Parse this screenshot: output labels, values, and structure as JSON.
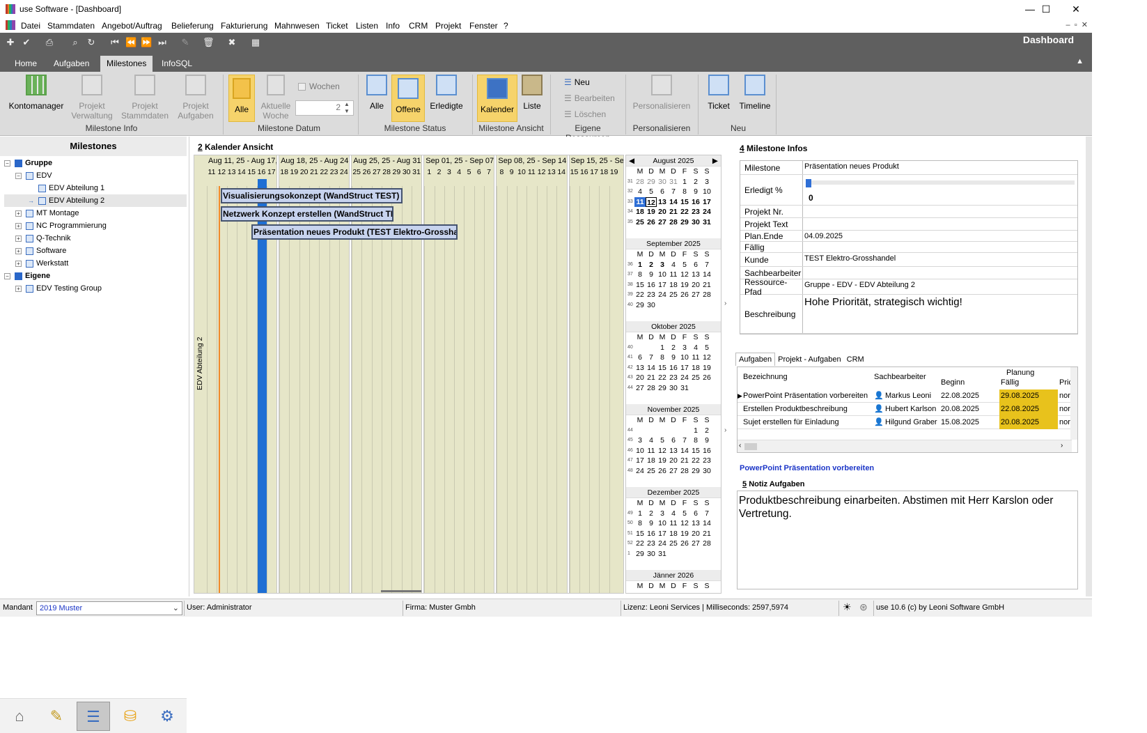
{
  "window": {
    "title": "use Software - [Dashboard]",
    "min": "—",
    "max": "☐",
    "close": "✕"
  },
  "menu": [
    "Datei",
    "Stammdaten",
    "Angebot/Auftrag",
    "Belieferung",
    "Fakturierung",
    "Mahnwesen",
    "Ticket",
    "Listen",
    "Info",
    "CRM",
    "Projekt",
    "Fenster",
    "?"
  ],
  "toolbar": {
    "right_title": "Dashboard"
  },
  "ribbon_tabs": [
    "Home",
    "Aufgaben",
    "Milestones",
    "InfoSQL"
  ],
  "ribbon": {
    "kontomanager": "Kontomanager",
    "projekt_verwaltung": "Projekt Verwaltung",
    "projekt_stammdaten": "Projekt Stammdaten",
    "projekt_aufgaben": "Projekt Aufgaben",
    "g_milestone_info": "Milestone Info",
    "alle": "Alle",
    "aktuelle_woche": "Aktuelle Woche",
    "wochen": "Wochen",
    "wochen_value": "2",
    "g_milestone_datum": "Milestone Datum",
    "status_alle": "Alle",
    "offene": "Offene",
    "erledigte": "Erledigte",
    "g_milestone_status": "Milestone Status",
    "kalender": "Kalender",
    "liste": "Liste",
    "g_milestone_ansicht": "Milestone Ansicht",
    "neu": "Neu",
    "bearbeiten": "Bearbeiten",
    "loeschen": "Löschen",
    "g_eigene_ressourcen": "Eigene Ressourcen",
    "personalisieren": "Personalisieren",
    "g_personalisieren": "Personalisieren",
    "ticket": "Ticket",
    "timeline": "Timeline",
    "g_neu": "Neu"
  },
  "left": {
    "title": "Milestones",
    "tree": [
      {
        "label": "Gruppe",
        "level": 0,
        "bold": true,
        "exp": "⊟",
        "icon": "sq"
      },
      {
        "label": "EDV",
        "level": 1,
        "exp": "⊟",
        "icon": "grp"
      },
      {
        "label": "EDV Abteilung 1",
        "level": 2,
        "icon": "grp"
      },
      {
        "label": "EDV Abteilung 2",
        "level": 2,
        "icon": "grp",
        "selected": true
      },
      {
        "label": "MT Montage",
        "level": 1,
        "exp": "⊞",
        "icon": "grp"
      },
      {
        "label": "NC Programmierung",
        "level": 1,
        "exp": "⊞",
        "icon": "grp"
      },
      {
        "label": "Q-Technik",
        "level": 1,
        "exp": "⊞",
        "icon": "grp"
      },
      {
        "label": "Software",
        "level": 1,
        "exp": "⊞",
        "icon": "grp"
      },
      {
        "label": "Werkstatt",
        "level": 1,
        "exp": "⊞",
        "icon": "grp"
      },
      {
        "label": "Eigene",
        "level": 0,
        "bold": true,
        "exp": "⊟",
        "icon": "sq"
      },
      {
        "label": "EDV Testing Group",
        "level": 1,
        "exp": "⊞",
        "icon": "grp"
      }
    ]
  },
  "calendar": {
    "num": "2",
    "title": "Kalender Ansicht",
    "lane": "EDV Abteilung 2",
    "weeks": [
      {
        "label": "Aug 11, 25 - Aug 17,",
        "days": [
          "11",
          "12",
          "13",
          "14",
          "15",
          "16",
          "17"
        ]
      },
      {
        "label": "Aug 18, 25 - Aug 24,",
        "days": [
          "18",
          "19",
          "20",
          "21",
          "22",
          "23",
          "24"
        ]
      },
      {
        "label": "Aug 25, 25 - Aug 31,",
        "days": [
          "25",
          "26",
          "27",
          "28",
          "29",
          "30",
          "31"
        ]
      },
      {
        "label": "Sep 01, 25 - Sep 07,",
        "days": [
          "1",
          "2",
          "3",
          "4",
          "5",
          "6",
          "7"
        ]
      },
      {
        "label": "Sep 08, 25 - Sep 14,",
        "days": [
          "8",
          "9",
          "10",
          "11",
          "12",
          "13",
          "14"
        ]
      },
      {
        "label": "Sep 15, 25 - Se",
        "days": [
          "15",
          "16",
          "17",
          "18",
          "19"
        ]
      }
    ],
    "bars": [
      "Visualisierungsokonzept (WandStruct TEST)",
      "Netzwerk Konzept erstellen (WandStruct TES",
      "Präsentation neues Produkt (TEST Elektro-Grosshande"
    ]
  },
  "minical": {
    "dow": [
      "M",
      "D",
      "M",
      "D",
      "F",
      "S",
      "S"
    ],
    "months": [
      {
        "name": "August 2025",
        "rows": [
          {
            "wk": "31",
            "d": [
              "28",
              "29",
              "30",
              "31",
              "1",
              "2",
              "3"
            ],
            "grey": [
              0,
              1,
              2,
              3
            ]
          },
          {
            "wk": "32",
            "d": [
              "4",
              "5",
              "6",
              "7",
              "8",
              "9",
              "10"
            ]
          },
          {
            "wk": "33",
            "d": [
              "11",
              "12",
              "13",
              "14",
              "15",
              "16",
              "17"
            ],
            "bold": true,
            "today": 0,
            "hl": 1
          },
          {
            "wk": "34",
            "d": [
              "18",
              "19",
              "20",
              "21",
              "22",
              "23",
              "24"
            ],
            "bold": true
          },
          {
            "wk": "35",
            "d": [
              "25",
              "26",
              "27",
              "28",
              "29",
              "30",
              "31"
            ],
            "bold": true
          }
        ]
      },
      {
        "name": "September 2025",
        "rows": [
          {
            "wk": "36",
            "d": [
              "1",
              "2",
              "3",
              "4",
              "5",
              "6",
              "7"
            ],
            "boldIdx": [
              0,
              1,
              2
            ]
          },
          {
            "wk": "37",
            "d": [
              "8",
              "9",
              "10",
              "11",
              "12",
              "13",
              "14"
            ]
          },
          {
            "wk": "38",
            "d": [
              "15",
              "16",
              "17",
              "18",
              "19",
              "20",
              "21"
            ]
          },
          {
            "wk": "39",
            "d": [
              "22",
              "23",
              "24",
              "25",
              "26",
              "27",
              "28"
            ]
          },
          {
            "wk": "40",
            "d": [
              "29",
              "30",
              "",
              "",
              "",
              "",
              ""
            ]
          }
        ]
      },
      {
        "name": "Oktober 2025",
        "rows": [
          {
            "wk": "40",
            "d": [
              "",
              "",
              "1",
              "2",
              "3",
              "4",
              "5"
            ]
          },
          {
            "wk": "41",
            "d": [
              "6",
              "7",
              "8",
              "9",
              "10",
              "11",
              "12"
            ]
          },
          {
            "wk": "42",
            "d": [
              "13",
              "14",
              "15",
              "16",
              "17",
              "18",
              "19"
            ]
          },
          {
            "wk": "43",
            "d": [
              "20",
              "21",
              "22",
              "23",
              "24",
              "25",
              "26"
            ]
          },
          {
            "wk": "44",
            "d": [
              "27",
              "28",
              "29",
              "30",
              "31",
              "",
              ""
            ]
          }
        ]
      },
      {
        "name": "November 2025",
        "rows": [
          {
            "wk": "44",
            "d": [
              "",
              "",
              "",
              "",
              "",
              "1",
              "2"
            ]
          },
          {
            "wk": "45",
            "d": [
              "3",
              "4",
              "5",
              "6",
              "7",
              "8",
              "9"
            ]
          },
          {
            "wk": "46",
            "d": [
              "10",
              "11",
              "12",
              "13",
              "14",
              "15",
              "16"
            ]
          },
          {
            "wk": "47",
            "d": [
              "17",
              "18",
              "19",
              "20",
              "21",
              "22",
              "23"
            ]
          },
          {
            "wk": "48",
            "d": [
              "24",
              "25",
              "26",
              "27",
              "28",
              "29",
              "30"
            ]
          }
        ]
      },
      {
        "name": "Dezember 2025",
        "rows": [
          {
            "wk": "49",
            "d": [
              "1",
              "2",
              "3",
              "4",
              "5",
              "6",
              "7"
            ]
          },
          {
            "wk": "50",
            "d": [
              "8",
              "9",
              "10",
              "11",
              "12",
              "13",
              "14"
            ]
          },
          {
            "wk": "51",
            "d": [
              "15",
              "16",
              "17",
              "18",
              "19",
              "20",
              "21"
            ]
          },
          {
            "wk": "52",
            "d": [
              "22",
              "23",
              "24",
              "25",
              "26",
              "27",
              "28"
            ]
          },
          {
            "wk": "1",
            "d": [
              "29",
              "30",
              "31",
              "",
              "",
              "",
              ""
            ]
          }
        ]
      },
      {
        "name": "Jänner 2026",
        "rows": []
      }
    ]
  },
  "info": {
    "num": "4",
    "title": "Milestone Infos",
    "rows": [
      {
        "k": "Milestone",
        "v": "Präsentation neues Produkt"
      },
      {
        "k": "Erledigt %",
        "v": "0",
        "progress": 0
      },
      {
        "k": "Projekt Nr.",
        "v": ""
      },
      {
        "k": "Projekt Text",
        "v": ""
      },
      {
        "k": "Plan.Ende",
        "v": "04.09.2025"
      },
      {
        "k": "Fällig",
        "v": ""
      },
      {
        "k": "Kunde",
        "v": "TEST Elektro-Grosshandel"
      },
      {
        "k": "Sachbearbeiter",
        "v": ""
      },
      {
        "k": "Ressource-Pfad",
        "v": "Gruppe - EDV - EDV Abteilung 2"
      },
      {
        "k": "Beschreibung",
        "v": "Hohe Priorität, strategisch wichtig!"
      }
    ]
  },
  "tasks": {
    "tabs": [
      "Aufgaben",
      "Projekt - Aufgaben",
      "CRM"
    ],
    "cols": {
      "bez": "Bezeichnung",
      "sb": "Sachbearbeiter",
      "planung": "Planung",
      "beginn": "Beginn",
      "faellig": "Fällig",
      "prio": "Pric"
    },
    "rows": [
      {
        "bez": "PowerPoint Präsentation vorbereiten",
        "sb": "Markus Leoni",
        "beginn": "22.08.2025",
        "faellig": "29.08.2025",
        "prio": "nor"
      },
      {
        "bez": "Erstellen Produktbeschreibung",
        "sb": "Hubert Karlson",
        "beginn": "20.08.2025",
        "faellig": "22.08.2025",
        "prio": "nor"
      },
      {
        "bez": "Sujet erstellen für Einladung",
        "sb": "Hilgund Graber",
        "beginn": "15.08.2025",
        "faellig": "20.08.2025",
        "prio": "nor"
      }
    ],
    "selected_title": "PowerPoint Präsentation vorbereiten",
    "notiz_num": "5",
    "notiz_title": "Notiz Aufgaben",
    "notiz": "Produktbeschreibung einarbeiten. Abstimen mit Herr Karslon oder Vertretung."
  },
  "status": {
    "mandant_label": "Mandant",
    "mandant_value": "2019 Muster",
    "user": "User: Administrator",
    "firma": "Firma: Muster Gmbh",
    "lizenz": "Lizenz: Leoni Services | Milliseconds: 2597,5974",
    "version": "use 10.6 (c) by Leoni Software GmbH"
  }
}
